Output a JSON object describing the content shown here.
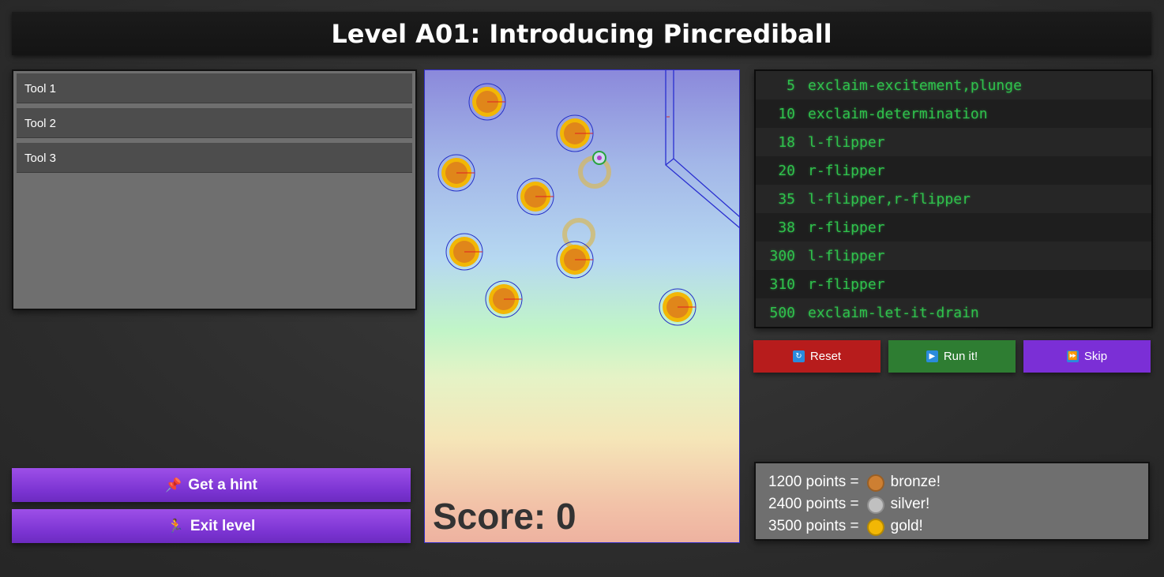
{
  "header": {
    "title": "Level A01: Introducing Pincrediball"
  },
  "tools": [
    {
      "label": "Tool 1"
    },
    {
      "label": "Tool 2"
    },
    {
      "label": "Tool 3"
    }
  ],
  "actions": {
    "hint": {
      "label": "Get a hint",
      "icon": "hint-icon"
    },
    "exit": {
      "label": "Exit level",
      "icon": "running-person-icon"
    }
  },
  "game": {
    "score_text": "Score: 0"
  },
  "script": [
    {
      "time": "5",
      "action": "exclaim-excitement,plunge"
    },
    {
      "time": "10",
      "action": "exclaim-determination"
    },
    {
      "time": "18",
      "action": "l-flipper"
    },
    {
      "time": "20",
      "action": "r-flipper"
    },
    {
      "time": "35",
      "action": "l-flipper,r-flipper"
    },
    {
      "time": "38",
      "action": "r-flipper"
    },
    {
      "time": "300",
      "action": "l-flipper"
    },
    {
      "time": "310",
      "action": "r-flipper"
    },
    {
      "time": "500",
      "action": "exclaim-let-it-drain"
    }
  ],
  "controls": {
    "reset": {
      "label": "Reset",
      "icon": "reset-icon",
      "color": "#b71c1c"
    },
    "run": {
      "label": "Run it!",
      "icon": "play-icon",
      "color": "#2e7d32"
    },
    "skip": {
      "label": "Skip",
      "icon": "fast-forward-icon",
      "color": "#7b2fd6"
    }
  },
  "medals": [
    {
      "points": "1200 points =",
      "name": "bronze!",
      "color": "#cd7f32"
    },
    {
      "points": "2400 points =",
      "name": "silver!",
      "color": "#c0c0c0"
    },
    {
      "points": "3500 points =",
      "name": "gold!",
      "color": "#f2b705"
    }
  ]
}
